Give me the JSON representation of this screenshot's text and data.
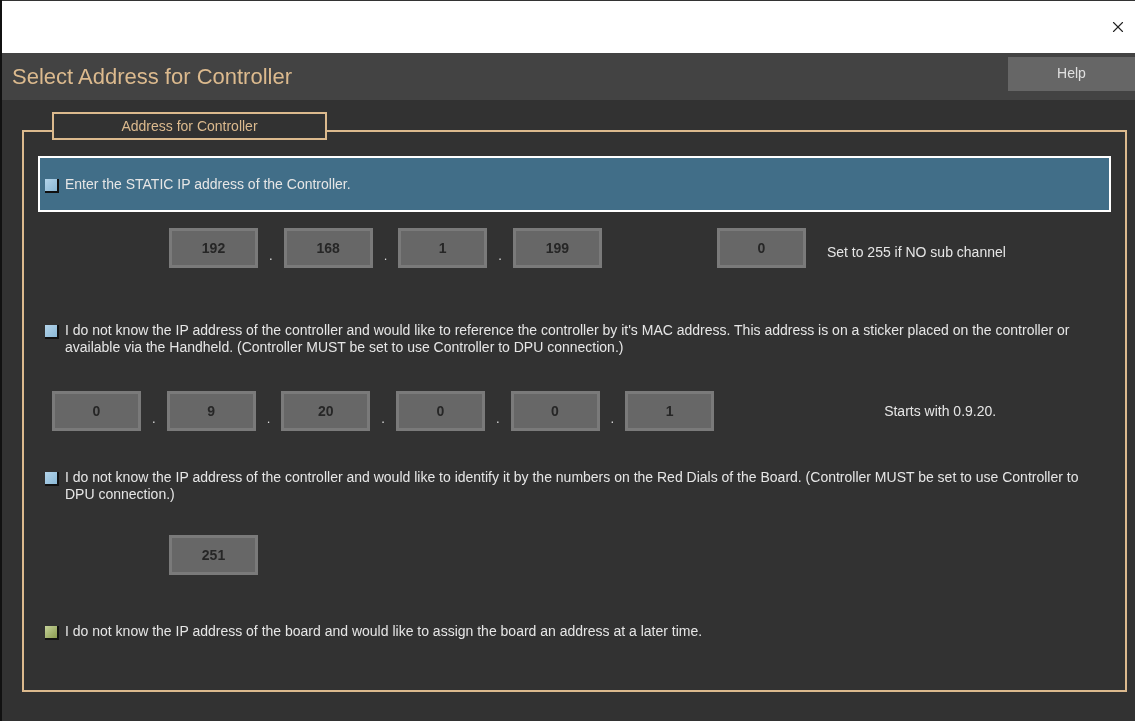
{
  "window": {
    "title": "Select Address for Controller",
    "help_button": "Help"
  },
  "group": {
    "legend": "Address for Controller",
    "options": [
      {
        "kind": "ip",
        "text": "Enter the STATIC IP address of the Controller.",
        "selected": false,
        "highlighted": true,
        "address": [
          {
            "kind": "field",
            "value": "192",
            "disabled": true
          },
          {
            "kind": "dot",
            "text": "."
          },
          {
            "kind": "field",
            "value": "168",
            "disabled": true
          },
          {
            "kind": "dot",
            "text": "."
          },
          {
            "kind": "field",
            "value": "1",
            "disabled": true
          },
          {
            "kind": "dot",
            "text": "."
          },
          {
            "kind": "field",
            "value": "199",
            "disabled": true
          }
        ],
        "sub_channel": {
          "value": "0",
          "disabled": true
        },
        "note": "Set to 255 if NO sub channel"
      },
      {
        "kind": "mac",
        "text": "I do not know the IP address of the controller and would like to reference the controller by it's MAC address.  This address is on a sticker placed on the controller or available via the Handheld. (Controller MUST be set to use Controller to DPU connection.)",
        "selected": false,
        "highlighted": false,
        "address": [
          {
            "kind": "field",
            "value": "0",
            "disabled": true
          },
          {
            "kind": "dot",
            "text": "."
          },
          {
            "kind": "field",
            "value": "9",
            "disabled": true
          },
          {
            "kind": "dot",
            "text": "."
          },
          {
            "kind": "field",
            "value": "20",
            "disabled": true
          },
          {
            "kind": "dot",
            "text": "."
          },
          {
            "kind": "field",
            "value": "0",
            "disabled": true
          },
          {
            "kind": "dot",
            "text": "."
          },
          {
            "kind": "field",
            "value": "0",
            "disabled": true
          },
          {
            "kind": "dot",
            "text": "."
          },
          {
            "kind": "field",
            "value": "1",
            "disabled": true
          }
        ],
        "note": "Starts with 0.9.20."
      },
      {
        "kind": "dial",
        "text": "I do not know the IP address of the controller and would like to identify it by the numbers on the Red Dials of the Board.  (Controller MUST be set to use Controller to DPU connection.)",
        "selected": false,
        "highlighted": false,
        "address": [
          {
            "kind": "field",
            "value": "251",
            "disabled": true
          }
        ]
      },
      {
        "kind": "later",
        "text": "I do not know the IP address of the board and would like to assign the board an address at a later time.",
        "selected": true,
        "highlighted": false
      }
    ]
  }
}
